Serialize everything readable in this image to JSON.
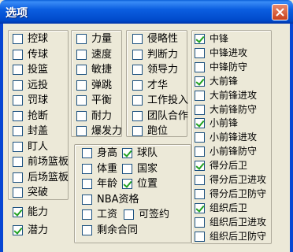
{
  "window": {
    "title": "选项"
  },
  "group_skills": [
    {
      "label": "控球",
      "checked": false
    },
    {
      "label": "传球",
      "checked": false
    },
    {
      "label": "投篮",
      "checked": false
    },
    {
      "label": "远投",
      "checked": false
    },
    {
      "label": "罚球",
      "checked": false
    },
    {
      "label": "抢断",
      "checked": false
    },
    {
      "label": "封盖",
      "checked": false
    },
    {
      "label": "盯人",
      "checked": false
    },
    {
      "label": "前场篮板",
      "checked": false
    },
    {
      "label": "后场篮板",
      "checked": false
    },
    {
      "label": "突破",
      "checked": false
    }
  ],
  "standalone": [
    {
      "label": "能力",
      "checked": true
    },
    {
      "label": "潜力",
      "checked": true
    }
  ],
  "group_physical": [
    {
      "label": "力量",
      "checked": false
    },
    {
      "label": "速度",
      "checked": false
    },
    {
      "label": "敏捷",
      "checked": false
    },
    {
      "label": "弹跳",
      "checked": false
    },
    {
      "label": "平衡",
      "checked": false
    },
    {
      "label": "耐力",
      "checked": false
    },
    {
      "label": "爆发力",
      "checked": false
    }
  ],
  "group_mental": [
    {
      "label": "侵略性",
      "checked": false
    },
    {
      "label": "判断力",
      "checked": false
    },
    {
      "label": "领导力",
      "checked": false
    },
    {
      "label": "才华",
      "checked": false
    },
    {
      "label": "工作投入",
      "checked": false
    },
    {
      "label": "团队合作",
      "checked": false
    },
    {
      "label": "跑位",
      "checked": false
    }
  ],
  "group_info": {
    "left": [
      {
        "label": "身高",
        "checked": false
      },
      {
        "label": "体重",
        "checked": false
      },
      {
        "label": "年龄",
        "checked": false
      },
      {
        "label": "NBA资格",
        "checked": false
      },
      {
        "label": "工资",
        "checked": false
      },
      {
        "label": "剩余合同",
        "checked": false
      }
    ],
    "right": [
      {
        "label": "球队",
        "checked": true
      },
      {
        "label": "国家",
        "checked": false
      },
      {
        "label": "位置",
        "checked": true
      },
      {
        "label": "可签约",
        "checked": false
      }
    ]
  },
  "group_positions": [
    {
      "label": "中锋",
      "checked": true
    },
    {
      "label": "中锋进攻",
      "checked": false
    },
    {
      "label": "中锋防守",
      "checked": false
    },
    {
      "label": "大前锋",
      "checked": true
    },
    {
      "label": "大前锋进攻",
      "checked": false
    },
    {
      "label": "大前锋防守",
      "checked": false
    },
    {
      "label": "小前锋",
      "checked": true
    },
    {
      "label": "小前锋进攻",
      "checked": false
    },
    {
      "label": "小前锋防守",
      "checked": false
    },
    {
      "label": "得分后卫",
      "checked": true
    },
    {
      "label": "得分后卫进攻",
      "checked": false
    },
    {
      "label": "得分后卫防守",
      "checked": false
    },
    {
      "label": "组织后卫",
      "checked": true
    },
    {
      "label": "组织后卫进攻",
      "checked": false
    },
    {
      "label": "组织后卫防守",
      "checked": false
    }
  ]
}
